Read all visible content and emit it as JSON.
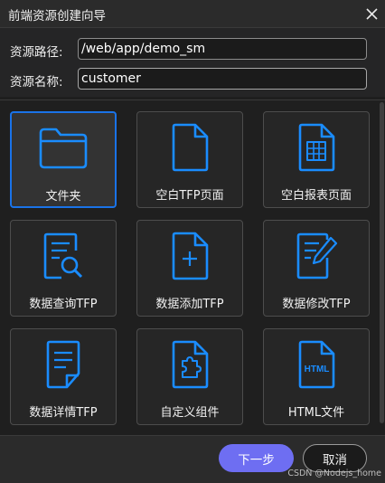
{
  "dialog": {
    "title": "前端资源创建向导",
    "close_icon": "close-icon"
  },
  "form": {
    "path_label": "资源路径:",
    "path_value": "/web/app/demo_sm",
    "name_label": "资源名称:",
    "name_value": "customer"
  },
  "tiles": [
    {
      "label": "文件夹",
      "icon": "folder-icon",
      "selected": true
    },
    {
      "label": "空白TFP页面",
      "icon": "blank-page-icon",
      "selected": false
    },
    {
      "label": "空白报表页面",
      "icon": "report-page-icon",
      "selected": false
    },
    {
      "label": "数据查询TFP",
      "icon": "data-query-icon",
      "selected": false
    },
    {
      "label": "数据添加TFP",
      "icon": "data-add-icon",
      "selected": false
    },
    {
      "label": "数据修改TFP",
      "icon": "data-edit-icon",
      "selected": false
    },
    {
      "label": "数据详情TFP",
      "icon": "data-detail-icon",
      "selected": false
    },
    {
      "label": "自定义组件",
      "icon": "custom-component-icon",
      "selected": false
    },
    {
      "label": "HTML文件",
      "icon": "html-file-icon",
      "selected": false,
      "icon_text": "HTML"
    }
  ],
  "footer": {
    "next_label": "下一步",
    "cancel_label": "取消"
  },
  "watermark": "CSDN @Nodejs_home",
  "colors": {
    "accent_blue": "#1a73e8",
    "primary_button": "#6e6ef2",
    "background": "#1e1e1e"
  }
}
